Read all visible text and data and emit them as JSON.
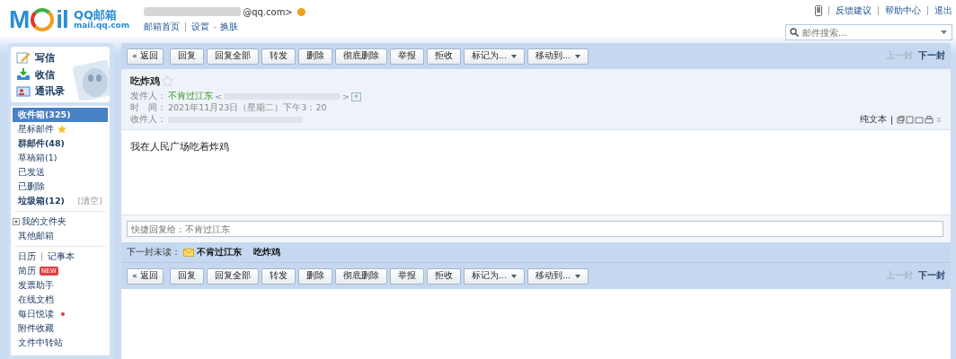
{
  "header": {
    "logo": "M",
    "logo_tail": "il",
    "brand": "QQ邮箱",
    "domain": "mail.qq.com",
    "account": "@qq.com>",
    "links": [
      "邮箱首页",
      "设置",
      "换肤"
    ],
    "link_separator": "-",
    "top_links": [
      "反馈建议",
      "帮助中心",
      "退出"
    ],
    "search": {
      "placeholder": "邮件搜索..."
    }
  },
  "sidebar": {
    "actions": [
      {
        "label": "写信",
        "kind": "write"
      },
      {
        "label": "收信",
        "kind": "inbox"
      },
      {
        "label": "通讯录",
        "kind": "contacts"
      }
    ],
    "folders": [
      {
        "label": "收件箱(325)",
        "selected": true,
        "bold": true,
        "kind": "plain"
      },
      {
        "label": "星标邮件",
        "selected": false,
        "bold": false,
        "kind": "star"
      },
      {
        "label": "群邮件(48)",
        "selected": false,
        "bold": true,
        "kind": "plain"
      },
      {
        "label": "草稿箱(1)",
        "selected": false,
        "bold": false,
        "kind": "plain"
      },
      {
        "label": "已发送",
        "selected": false,
        "bold": false,
        "kind": "plain"
      },
      {
        "label": "已删除",
        "selected": false,
        "bold": false,
        "kind": "plain"
      },
      {
        "label": "垃圾箱(12)",
        "selected": false,
        "bold": true,
        "kind": "clear",
        "extra": "[清空]"
      }
    ],
    "my_folders": [
      {
        "label": "我的文件夹",
        "kind": "expander"
      },
      {
        "label": "其他邮箱",
        "kind": "plain"
      }
    ],
    "tools": [
      {
        "label": "日历",
        "kind": "pair",
        "label2": "记事本"
      },
      {
        "label": "简历",
        "kind": "badge",
        "badge": "NEW"
      },
      {
        "label": "发票助手",
        "kind": "plain"
      },
      {
        "label": "在线文档",
        "kind": "plain"
      },
      {
        "label": "每日悦读",
        "kind": "dot",
        "color": "#e0393e"
      },
      {
        "label": "附件收藏",
        "kind": "plain"
      },
      {
        "label": "文件中转站",
        "kind": "plain"
      }
    ]
  },
  "toolbar": {
    "buttons": [
      {
        "label": "« 返回",
        "kind": "back"
      },
      {
        "label": "回复",
        "kind": "plain"
      },
      {
        "label": "回复全部",
        "kind": "plain"
      },
      {
        "label": "转发",
        "kind": "plain"
      },
      {
        "label": "删除",
        "kind": "plain"
      },
      {
        "label": "彻底删除",
        "kind": "plain"
      },
      {
        "label": "举报",
        "kind": "plain"
      },
      {
        "label": "拒收",
        "kind": "plain"
      },
      {
        "label": "标记为...",
        "kind": "dropdown"
      },
      {
        "label": "移动到...",
        "kind": "dropdown"
      }
    ],
    "pager": [
      {
        "label": "上一封",
        "disabled": true
      },
      {
        "label": "下一封",
        "disabled": false
      }
    ]
  },
  "mail": {
    "subject": "吃炸鸡",
    "starred": false,
    "from_label": "发件人：",
    "from_name": "不肯过江东",
    "from_open": "<",
    "from_close": ">",
    "time_label": "时　间：",
    "time": "2021年11月23日（星期二）下午3：20",
    "to_label": "收件人：",
    "plain_text": "纯文本",
    "body": "我在人民广场吃着炸鸡",
    "quick_reply": {
      "placeholder": "快捷回复给：不肯过江东"
    },
    "next_unread": {
      "label": "下一封未读：",
      "sender": "不肯过江东",
      "subject": "吃炸鸡"
    }
  },
  "bottom_toolbar": {
    "buttons": [
      {
        "label": "« 返回",
        "kind": "back"
      },
      {
        "label": "回复",
        "kind": "plain"
      },
      {
        "label": "回复全部",
        "kind": "plain"
      },
      {
        "label": "转发",
        "kind": "plain"
      },
      {
        "label": "删除",
        "kind": "plain"
      },
      {
        "label": "彻底删除",
        "kind": "plain"
      },
      {
        "label": "举报",
        "kind": "plain"
      },
      {
        "label": "拒收",
        "kind": "plain"
      },
      {
        "label": "标记为...",
        "kind": "dropdown"
      },
      {
        "label": "移动到...",
        "kind": "dropdown"
      }
    ],
    "pager": [
      {
        "label": "上一封",
        "disabled": true
      },
      {
        "label": "下一封",
        "disabled": false
      }
    ]
  }
}
